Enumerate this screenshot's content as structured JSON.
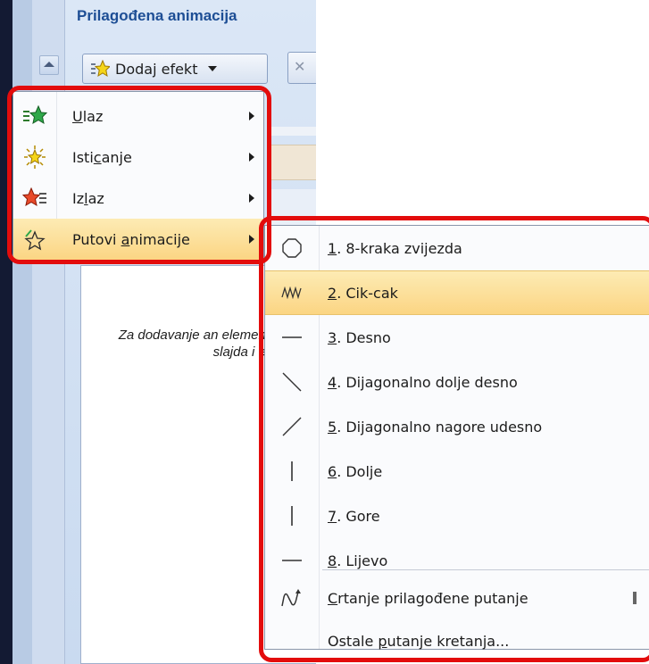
{
  "pane": {
    "title": "Prilagođena animacija",
    "add_effect_label": "Dodaj efekt",
    "hint_text": "Za dodavanje an element slajda i ef"
  },
  "add_effect_menu": {
    "items": [
      {
        "label": "Ulaz",
        "underline": "U",
        "icon": "entrance-star-icon",
        "has_submenu": true,
        "highlighted": false
      },
      {
        "label": "Isticanje",
        "underline": "c",
        "icon": "emphasis-star-icon",
        "has_submenu": true,
        "highlighted": false
      },
      {
        "label": "Izlaz",
        "underline": "l",
        "icon": "exit-star-icon",
        "has_submenu": true,
        "highlighted": false
      },
      {
        "label": "Putovi animacije",
        "underline": "a",
        "icon": "motion-path-star-icon",
        "has_submenu": true,
        "highlighted": true
      }
    ]
  },
  "motion_paths_menu": {
    "items": [
      {
        "label": "1. 8-kraka zvijezda",
        "icon": "octagon-path-icon"
      },
      {
        "label": "2. Cik-cak",
        "icon": "zigzag-path-icon",
        "highlighted": true
      },
      {
        "label": "3. Desno",
        "icon": "right-path-icon"
      },
      {
        "label": "4. Dijagonalno dolje desno",
        "icon": "diagonal-down-right-icon"
      },
      {
        "label": "5. Dijagonalno nagore udesno",
        "icon": "diagonal-up-right-icon"
      },
      {
        "label": "6. Dolje",
        "icon": "down-path-icon"
      },
      {
        "label": "7. Gore",
        "icon": "up-path-icon"
      },
      {
        "label": "8. Lijevo",
        "icon": "left-path-icon"
      },
      {
        "label": "Crtanje prilagođene putanje",
        "icon": "custom-path-icon"
      },
      {
        "label": "Ostale putanje kretanja...",
        "icon": ""
      }
    ]
  },
  "colors": {
    "highlight": "#fbd583",
    "callout_red": "#e30c0c",
    "title_blue": "#1d4e95"
  }
}
